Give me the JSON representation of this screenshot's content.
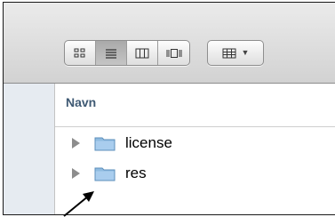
{
  "toolbar": {
    "view_buttons": [
      {
        "icon": "icon-view-icon",
        "active": false
      },
      {
        "icon": "list-view-icon",
        "active": true
      },
      {
        "icon": "column-view-icon",
        "active": false
      },
      {
        "icon": "cover-flow-icon",
        "active": false
      }
    ],
    "arrange_button": {
      "icon": "arrange-icon",
      "dropdown": "chevron-down-icon"
    }
  },
  "file_list": {
    "column_header": "Navn",
    "items": [
      {
        "name": "license",
        "icon": "folder-icon"
      },
      {
        "name": "res",
        "icon": "folder-icon"
      }
    ]
  },
  "annotation": {
    "icon": "pointer-arrow-icon"
  }
}
